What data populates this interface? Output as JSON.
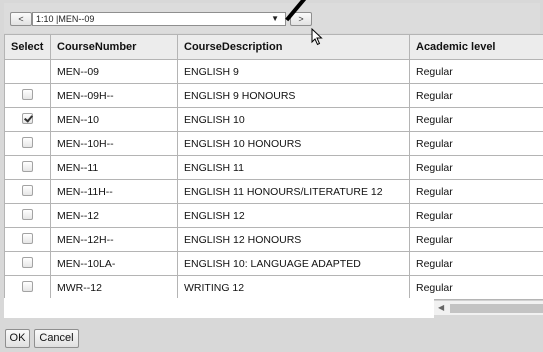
{
  "navigation": {
    "prev_label": "<",
    "next_label": ">",
    "selector_value": "1:10 |MEN--09"
  },
  "columns": [
    "Select",
    "CourseNumber",
    "CourseDescription",
    "Academic level"
  ],
  "rows": [
    {
      "number": "MEN--09",
      "description": "ENGLISH 9",
      "level": "Regular",
      "has_checkbox": false,
      "checked": false
    },
    {
      "number": "MEN--09H--",
      "description": "ENGLISH 9 HONOURS",
      "level": "Regular",
      "has_checkbox": true,
      "checked": false
    },
    {
      "number": "MEN--10",
      "description": "ENGLISH 10",
      "level": "Regular",
      "has_checkbox": true,
      "checked": true
    },
    {
      "number": "MEN--10H--",
      "description": "ENGLISH 10 HONOURS",
      "level": "Regular",
      "has_checkbox": true,
      "checked": false
    },
    {
      "number": "MEN--11",
      "description": "ENGLISH 11",
      "level": "Regular",
      "has_checkbox": true,
      "checked": false
    },
    {
      "number": "MEN--11H--",
      "description": "ENGLISH 11 HONOURS/LITERATURE 12",
      "level": "Regular",
      "has_checkbox": true,
      "checked": false
    },
    {
      "number": "MEN--12",
      "description": "ENGLISH 12",
      "level": "Regular",
      "has_checkbox": true,
      "checked": false
    },
    {
      "number": "MEN--12H--",
      "description": "ENGLISH 12 HONOURS",
      "level": "Regular",
      "has_checkbox": true,
      "checked": false
    },
    {
      "number": "MEN--10LA-",
      "description": "ENGLISH 10: LANGUAGE ADAPTED",
      "level": "Regular",
      "has_checkbox": true,
      "checked": false
    },
    {
      "number": "MWR--12",
      "description": "WRITING 12",
      "level": "Regular",
      "has_checkbox": true,
      "checked": false
    }
  ],
  "footer": {
    "ok_label": "OK",
    "cancel_label": "Cancel"
  }
}
